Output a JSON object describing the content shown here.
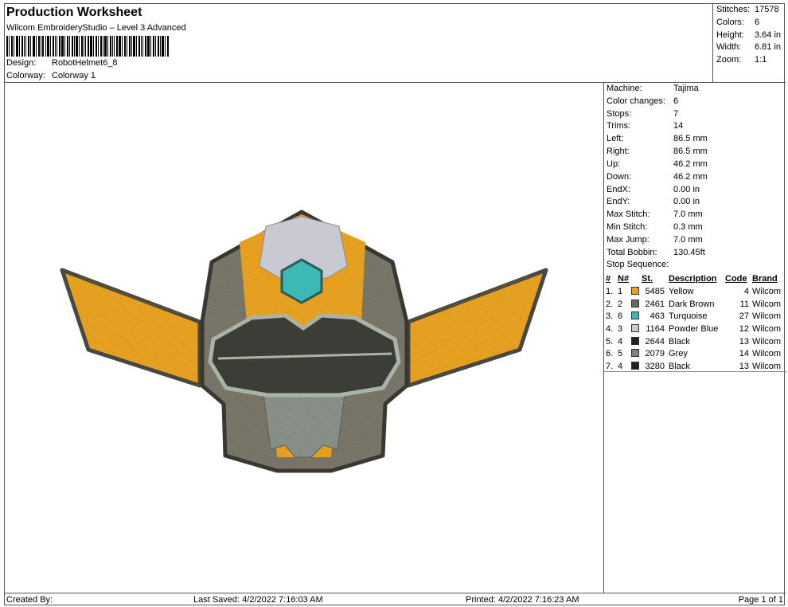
{
  "header": {
    "title": "Production Worksheet",
    "subtitle": "Wilcom EmbroideryStudio – Level 3 Advanced",
    "design_label": "Design:",
    "design_value": "RobotHelmet6_8",
    "colorway_label": "Colorway:",
    "colorway_value": "Colorway 1"
  },
  "top_stats": [
    {
      "label": "Stitches:",
      "value": "17578"
    },
    {
      "label": "Colors:",
      "value": "6"
    },
    {
      "label": "Height:",
      "value": "3.64 in"
    },
    {
      "label": "Width:",
      "value": "6.81 in"
    },
    {
      "label": "Zoom:",
      "value": "1:1"
    }
  ],
  "machine_stats": [
    {
      "label": "Machine:",
      "value": "Tajima"
    },
    {
      "label": "Color changes:",
      "value": "6"
    },
    {
      "label": "Stops:",
      "value": "7"
    },
    {
      "label": "Trims:",
      "value": "14"
    },
    {
      "label": "Left:",
      "value": "86.5 mm"
    },
    {
      "label": "Right:",
      "value": "86.5 mm"
    },
    {
      "label": "Up:",
      "value": "46.2 mm"
    },
    {
      "label": "Down:",
      "value": "46.2 mm"
    },
    {
      "label": "EndX:",
      "value": "0.00 in"
    },
    {
      "label": "EndY:",
      "value": "0.00 in"
    },
    {
      "label": "Max Stitch:",
      "value": "7.0 mm"
    },
    {
      "label": "Min Stitch:",
      "value": "0.3 mm"
    },
    {
      "label": "Max Jump:",
      "value": "7.0 mm"
    },
    {
      "label": "Total Bobbin:",
      "value": "130.45ft"
    }
  ],
  "stop_sequence": {
    "title": "Stop Sequence:",
    "headers": {
      "num": "#",
      "n": "N#",
      "st": "St.",
      "description": "Description",
      "code": "Code",
      "brand": "Brand"
    },
    "rows": [
      {
        "num": "1.",
        "n": "1",
        "color": "#f0a020",
        "st": "5485",
        "description": "Yellow",
        "code": "4",
        "brand": "Wilcom"
      },
      {
        "num": "2.",
        "n": "2",
        "color": "#6e675c",
        "st": "2461",
        "description": "Dark Brown",
        "code": "11",
        "brand": "Wilcom"
      },
      {
        "num": "3.",
        "n": "6",
        "color": "#3bb6b4",
        "st": "463",
        "description": "Turquoise",
        "code": "27",
        "brand": "Wilcom"
      },
      {
        "num": "4.",
        "n": "3",
        "color": "#c8c8d8",
        "st": "1164",
        "description": "Powder Blue",
        "code": "12",
        "brand": "Wilcom"
      },
      {
        "num": "5.",
        "n": "4",
        "color": "#222222",
        "st": "2644",
        "description": "Black",
        "code": "13",
        "brand": "Wilcom"
      },
      {
        "num": "6.",
        "n": "5",
        "color": "#808080",
        "st": "2079",
        "description": "Grey",
        "code": "14",
        "brand": "Wilcom"
      },
      {
        "num": "7.",
        "n": "4",
        "color": "#222222",
        "st": "3280",
        "description": "Black",
        "code": "13",
        "brand": "Wilcom"
      }
    ]
  },
  "footer": {
    "created_by": "Created By:",
    "last_saved": "Last Saved: 4/2/2022 7:16:03 AM",
    "printed": "Printed: 4/2/2022 7:16:23 AM",
    "page": "Page 1 of 1"
  }
}
